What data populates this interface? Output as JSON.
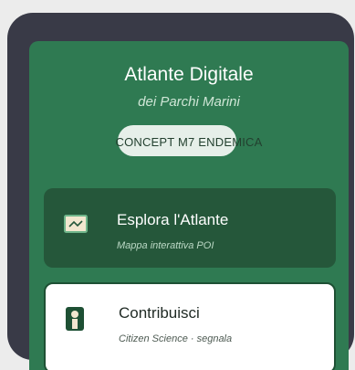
{
  "header": {
    "title": "Atlante Digitale",
    "subtitle": "dei Parchi Marini",
    "concept_label": "CONCEPT M7 ENDEMICA"
  },
  "menu": {
    "items": [
      {
        "title": "Esplora l'Atlante",
        "subtitle": "Mappa interattiva POI",
        "icon": "map-icon"
      },
      {
        "title": "Contribuisci",
        "subtitle": "Citizen Science · segnala",
        "icon": "person-icon"
      }
    ]
  },
  "colors": {
    "frame": "#393a47",
    "screen": "#2f7a52",
    "card_dark": "#25573a",
    "card_light": "#ffffff",
    "pill": "#e6efe9"
  }
}
